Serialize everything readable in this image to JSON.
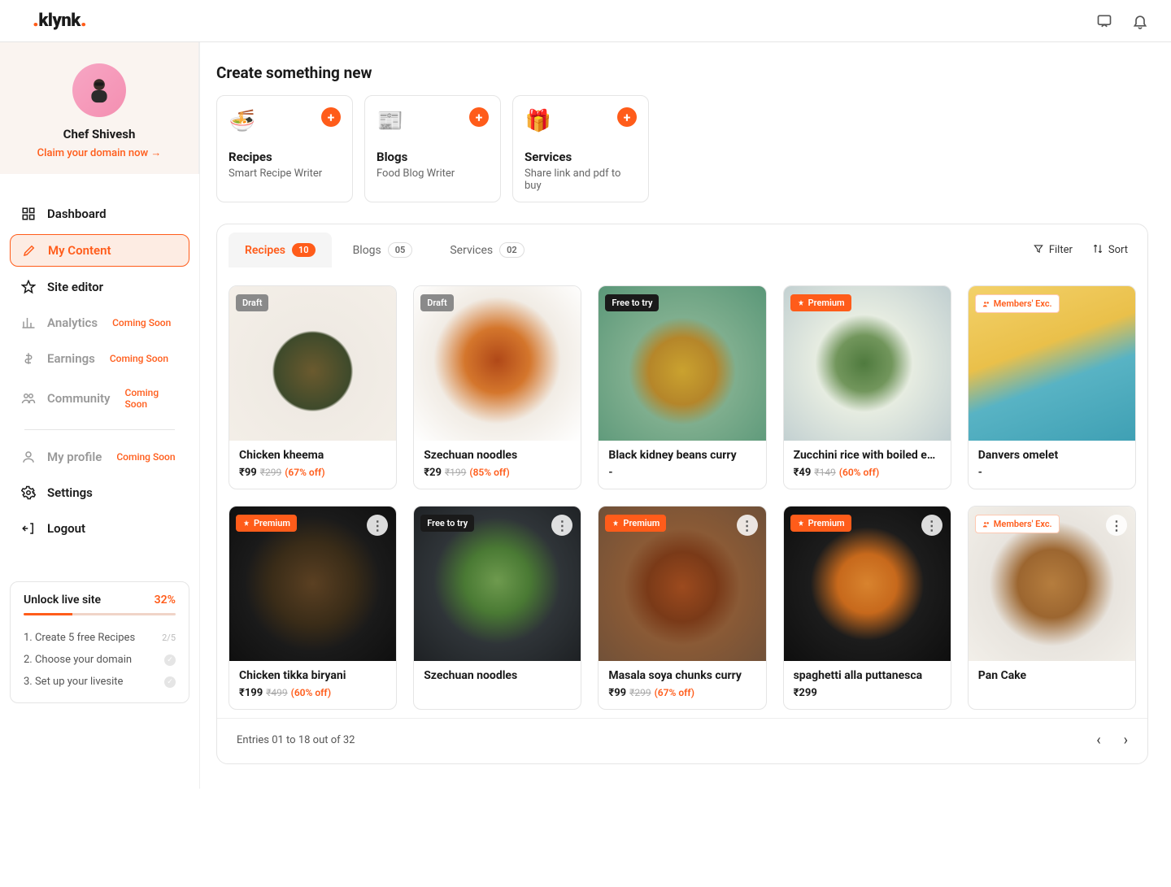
{
  "brand": "klynk",
  "user": {
    "name": "Chef Shivesh",
    "claim": "Claim your domain now →"
  },
  "nav": {
    "dashboard": "Dashboard",
    "my_content": "My Content",
    "site_editor": "Site editor",
    "analytics": "Analytics",
    "earnings": "Earnings",
    "community": "Community",
    "my_profile": "My profile",
    "settings": "Settings",
    "logout": "Logout",
    "soon": "Coming Soon"
  },
  "create": {
    "title": "Create something new",
    "cards": [
      {
        "title": "Recipes",
        "sub": "Smart Recipe Writer",
        "emoji": "🍜"
      },
      {
        "title": "Blogs",
        "sub": "Food Blog Writer",
        "emoji": "📰"
      },
      {
        "title": "Services",
        "sub": "Share link and pdf to buy",
        "emoji": "🎁"
      }
    ]
  },
  "tabs": [
    {
      "label": "Recipes",
      "count": "10",
      "active": true
    },
    {
      "label": "Blogs",
      "count": "05",
      "active": false
    },
    {
      "label": "Services",
      "count": "02",
      "active": false
    }
  ],
  "actions": {
    "filter": "Filter",
    "sort": "Sort"
  },
  "recipes": [
    {
      "title": "Chicken kheema",
      "price": "₹99",
      "strike": "₹299",
      "discount": "(67% off)",
      "badge": "Draft",
      "badgeType": "draft",
      "img": "food-1"
    },
    {
      "title": "Szechuan noodles",
      "price": "₹29",
      "strike": "₹199",
      "discount": "(85% off)",
      "badge": "Draft",
      "badgeType": "draft",
      "img": "food-2"
    },
    {
      "title": "Black kidney beans curry",
      "price": "-",
      "strike": "",
      "discount": "",
      "badge": "Free to try",
      "badgeType": "free",
      "img": "food-3"
    },
    {
      "title": "Zucchini rice with boiled eg...",
      "price": "₹49",
      "strike": "₹149",
      "discount": "(60% off)",
      "badge": "Premium",
      "badgeType": "premium",
      "img": "food-4"
    },
    {
      "title": "Danvers omelet",
      "price": "-",
      "strike": "",
      "discount": "",
      "badge": "Members' Exc.",
      "badgeType": "members",
      "img": "food-5"
    },
    {
      "title": "Chicken tikka biryani",
      "price": "₹199",
      "strike": "₹499",
      "discount": "(60% off)",
      "badge": "Premium",
      "badgeType": "premium",
      "img": "food-6",
      "more": true
    },
    {
      "title": "Szechuan noodles",
      "price": "",
      "strike": "",
      "discount": "",
      "badge": "Free to try",
      "badgeType": "free",
      "img": "food-7",
      "more": true
    },
    {
      "title": "Masala soya chunks curry",
      "price": "₹99",
      "strike": "₹299",
      "discount": "(67% off)",
      "badge": "Premium",
      "badgeType": "premium",
      "img": "food-8",
      "more": true
    },
    {
      "title": "spaghetti alla puttanesca",
      "price": "₹299",
      "strike": "",
      "discount": "",
      "badge": "Premium",
      "badgeType": "premium",
      "img": "food-9",
      "more": true
    },
    {
      "title": "Pan Cake",
      "price": "",
      "strike": "",
      "discount": "",
      "badge": "Members' Exc.",
      "badgeType": "members",
      "img": "food-10",
      "more": true
    }
  ],
  "pager": "Entries 01 to 18 out of 32",
  "unlock": {
    "title": "Unlock live site",
    "pct": "32%",
    "pctNum": 32,
    "steps": [
      {
        "label": "1.  Create 5 free Recipes",
        "right": "2/5",
        "done": false
      },
      {
        "label": "2.  Choose your domain",
        "right": "check",
        "done": true
      },
      {
        "label": "3.  Set up your livesite",
        "right": "check",
        "done": true
      }
    ]
  }
}
